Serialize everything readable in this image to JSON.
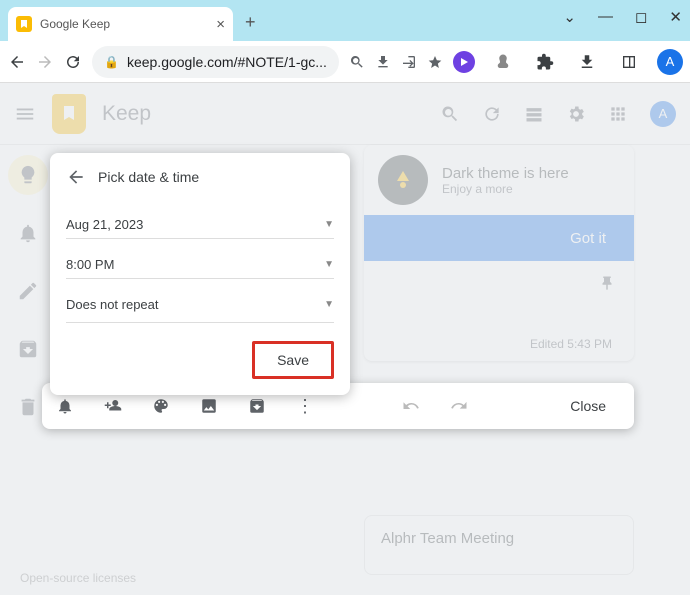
{
  "browser": {
    "tab_title": "Google Keep",
    "url": "keep.google.com/#NOTE/1-gc..."
  },
  "app": {
    "title": "Keep",
    "avatar_letter": "A"
  },
  "promo": {
    "title": "Dark theme is here",
    "subtitle": "Enjoy a more",
    "button": "Got it"
  },
  "editor": {
    "edited": "Edited 5:43 PM",
    "close": "Close"
  },
  "date_modal": {
    "title": "Pick date & time",
    "date": "Aug 21, 2023",
    "time": "8:00 PM",
    "repeat": "Does not repeat",
    "save": "Save"
  },
  "note": {
    "title": "Alphr Team Meeting"
  },
  "footer": {
    "licenses": "Open-source licenses"
  }
}
